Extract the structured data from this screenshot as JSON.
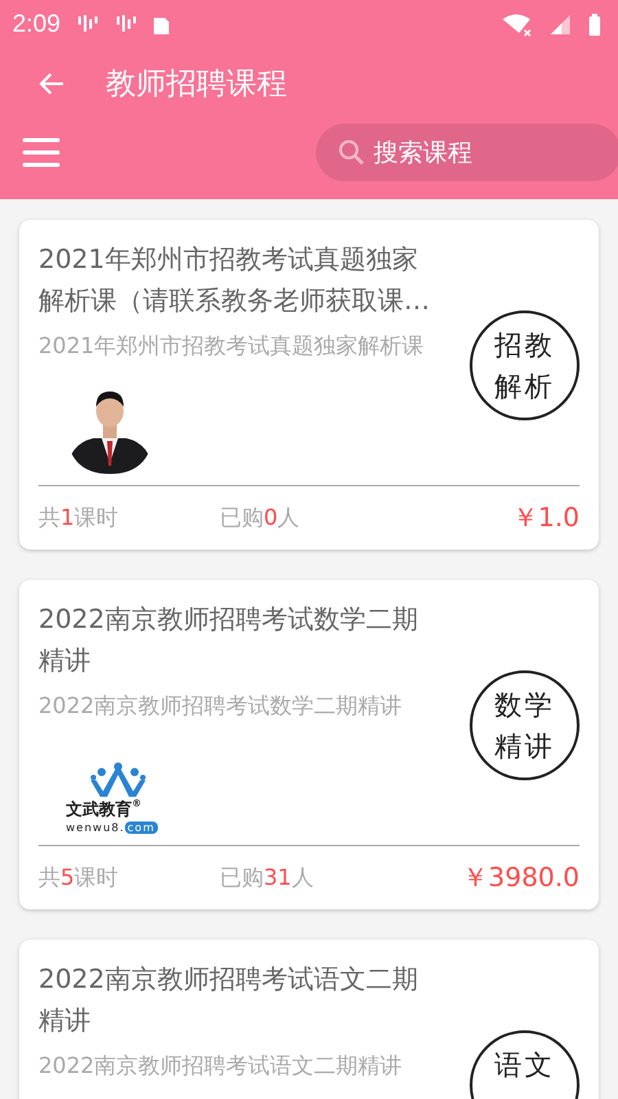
{
  "status_bar": {
    "time": "2:09"
  },
  "toolbar": {
    "title": "教师招聘课程",
    "search": {
      "placeholder": "搜索课程"
    }
  },
  "courses": [
    {
      "title_lines": [
        "2021年郑州市招教考试真题独家",
        "解析课（请联系教务老师获取课…"
      ],
      "subtitle": "2021年郑州市招教考试真题独家解析课",
      "cover": {
        "kind": "person"
      },
      "badge": [
        "招教",
        "解析"
      ],
      "lessons": [
        "共",
        "1",
        "课时"
      ],
      "buyers": [
        "已购",
        "0",
        "人"
      ],
      "price": "￥1.0"
    },
    {
      "title_lines": [
        "2022南京教师招聘考试数学二期",
        "精讲"
      ],
      "subtitle": "2022南京教师招聘考试数学二期精讲",
      "cover": {
        "kind": "logo",
        "name": "文武教育",
        "mark": "®",
        "domain": "wenwu8.",
        "tld": "com"
      },
      "badge": [
        "数学",
        "精讲"
      ],
      "lessons": [
        "共",
        "5",
        "课时"
      ],
      "buyers": [
        "已购",
        "31",
        "人"
      ],
      "price": "￥3980.0"
    },
    {
      "title_lines": [
        "2022南京教师招聘考试语文二期",
        "精讲"
      ],
      "subtitle": "2022南京教师招聘考试语文二期精讲",
      "badge": [
        "语文"
      ]
    }
  ]
}
